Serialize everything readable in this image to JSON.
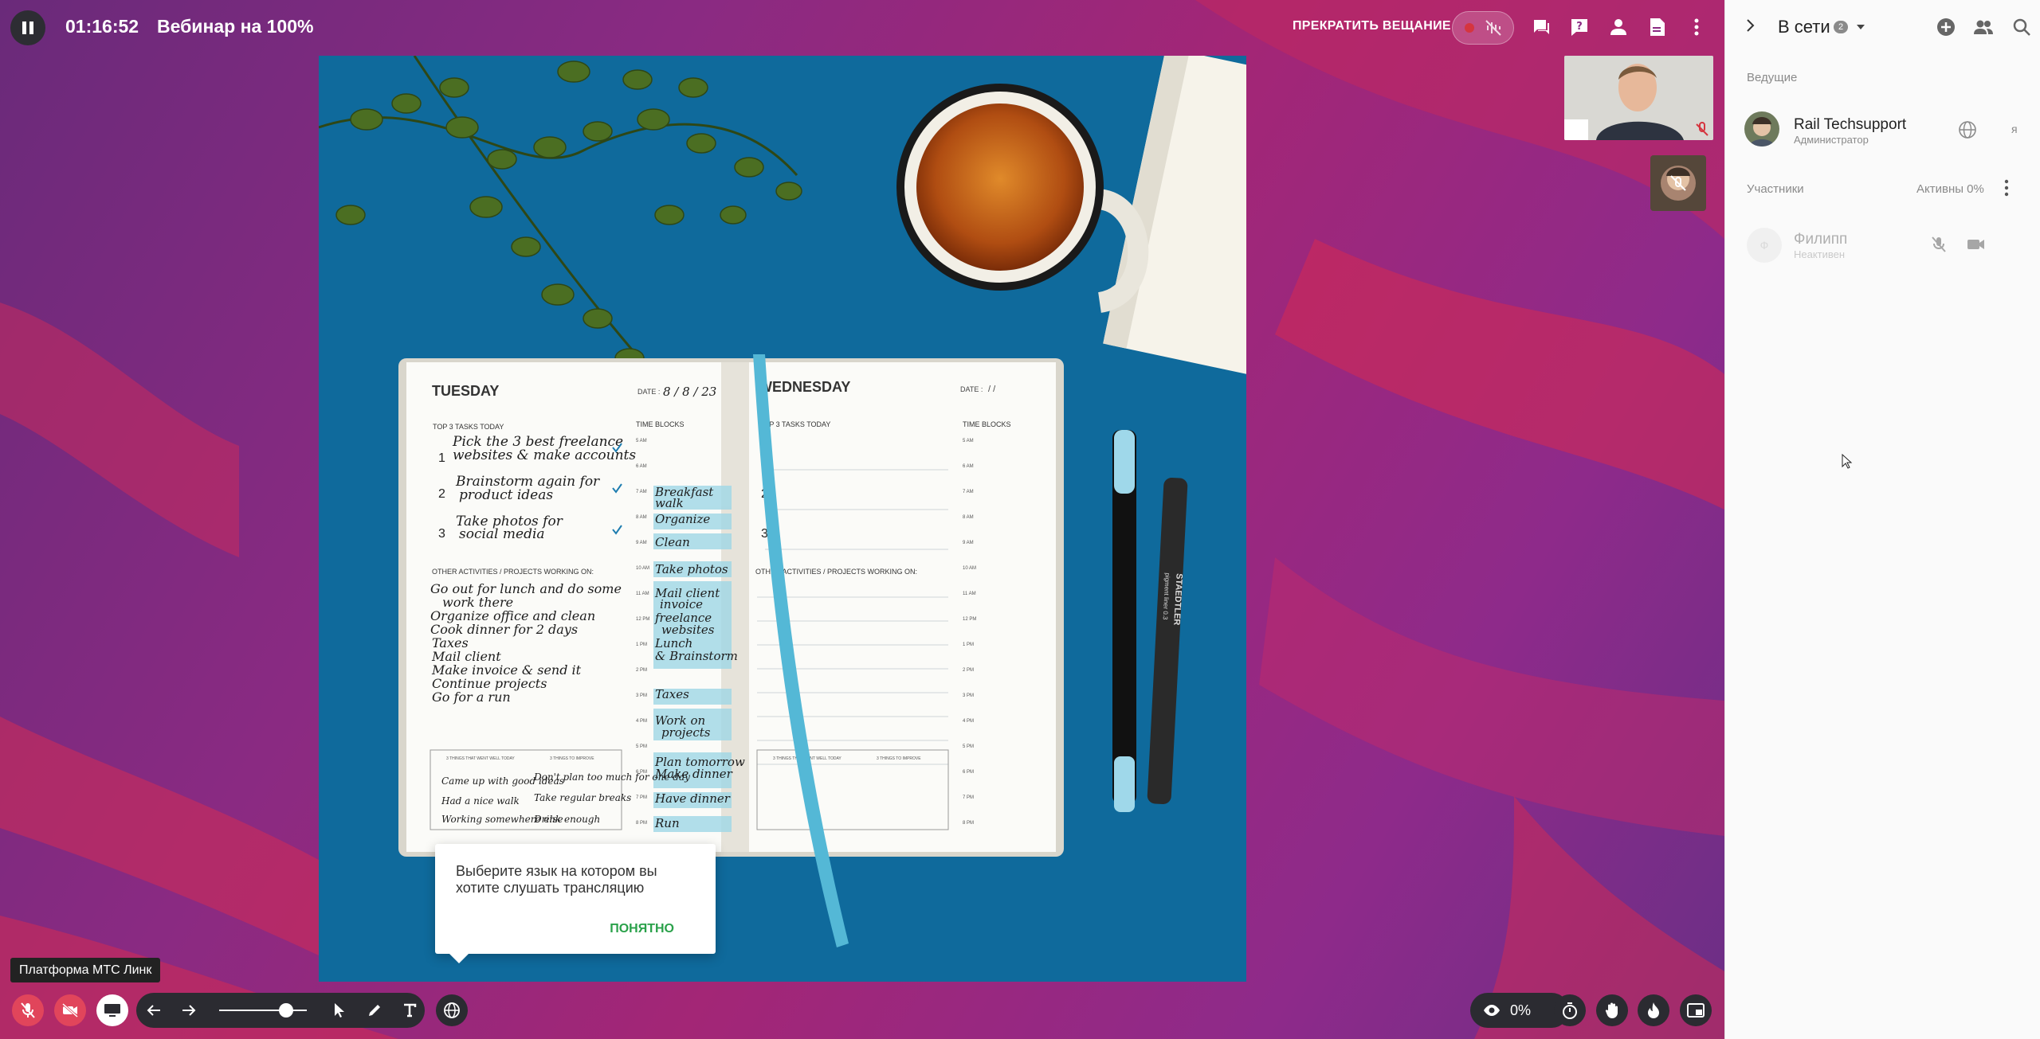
{
  "topbar": {
    "timer": "01:16:52",
    "title": "Вебинар на 100%",
    "stop_broadcast": "ПРЕКРАТИТЬ ВЕЩАНИЕ",
    "icons": [
      "chat-icon",
      "question-icon",
      "person-icon",
      "document-icon",
      "more-vertical-icon"
    ]
  },
  "photo": {
    "planner": {
      "left_day": "TUESDAY",
      "left_date_label": "DATE :",
      "left_date": "8 / 8 / 23",
      "right_day": "WEDNESDAY",
      "right_date_label": "DATE :",
      "right_date": "/ /",
      "tasks_heading": "TOP 3 TASKS TODAY",
      "time_blocks": "TIME BLOCKS",
      "tasks": [
        "Pick the 3 best freelance",
        "websites & make accounts",
        "Brainstorm again for",
        "product ideas",
        "Take photos for",
        "social media"
      ],
      "other_heading": "OTHER ACTIVITIES / PROJECTS WORKING ON:",
      "other_items": [
        "Go out for lunch and do some",
        "work there",
        "Organize office and clean",
        "Cook dinner for 2 days",
        "Taxes",
        "Mail client",
        "Make invoice & send it",
        "Continue projects",
        "Go for a run"
      ],
      "blocks": [
        "Breakfast",
        "walk",
        "Organize",
        "Clean",
        "Take photos",
        "Mail client",
        "invoice",
        "freelance",
        "websites",
        "Lunch",
        "& Brainstorm",
        "Taxes",
        "Work on",
        "projects",
        "Plan tomorrow",
        "Make dinner",
        "Have dinner",
        "Run"
      ],
      "went_well_heading": "3 THINGS THAT WENT WELL TODAY",
      "improve_heading": "3 THINGS TO IMPROVE",
      "went_well": [
        "Came up with good ideas",
        "Had a nice walk",
        "Working somewhere else"
      ],
      "improve": [
        "Don't plan too much for one day",
        "Take regular breaks",
        "Drink enough"
      ],
      "right_tasks_heading": "TOP 3 TASKS TODAY",
      "right_other_heading": "OTHER ACTIVITIES / PROJECTS WORKING ON:",
      "pen_brand": "STAEDTLER",
      "pen_label": "pigment liner 0.3",
      "hours": [
        "5 AM",
        "6 AM",
        "7 AM",
        "8 AM",
        "9 AM",
        "10 AM",
        "11 AM",
        "12 PM",
        "1 PM",
        "2 PM",
        "3 PM",
        "4 PM",
        "5 PM",
        "6 PM",
        "7 PM",
        "8 PM"
      ]
    }
  },
  "tooltip": {
    "text": "Выберите язык на котором вы хотите слушать трансляцию",
    "button": "ПОНЯТНО"
  },
  "brand_tip": "Платформа МТС Линк",
  "bottombar": {
    "viewer_percent": "0%"
  },
  "sidebar": {
    "online_label": "В сети",
    "online_count": "2",
    "hosts_heading": "Ведущие",
    "host": {
      "name": "Rail Techsupport",
      "role": "Администратор",
      "me": "я"
    },
    "participants_heading": "Участники",
    "active_label": "Активны 0%",
    "participant": {
      "initial": "Ф",
      "name": "Филипп",
      "status": "Неактивен"
    }
  },
  "colors": {
    "accent_green": "#2aa14a",
    "mic_off_red": "#e1455b",
    "stage_purple": "#8a2a82"
  }
}
